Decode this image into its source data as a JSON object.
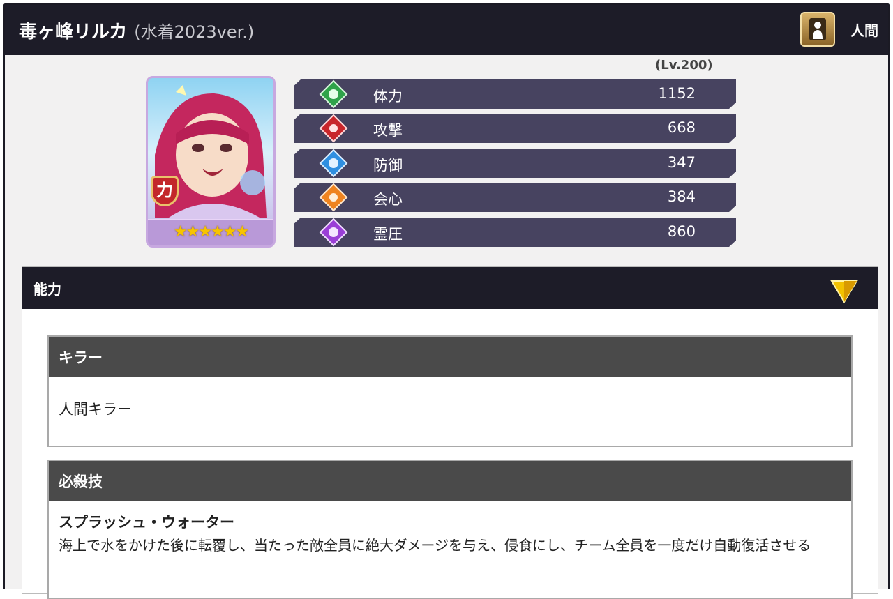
{
  "header": {
    "name": "毒ヶ峰リルカ",
    "version": "(水着2023ver.)",
    "type_label": "人間",
    "type_icon": "human-type-icon"
  },
  "card": {
    "attribute": "力",
    "stars": "★★★★★★"
  },
  "stats": {
    "level": "(Lv.200)",
    "rows": [
      {
        "label": "体力",
        "value": "1152",
        "icon": "stamina-icon",
        "color": "#2fa34a"
      },
      {
        "label": "攻撃",
        "value": "668",
        "icon": "attack-icon",
        "color": "#c8262b"
      },
      {
        "label": "防御",
        "value": "347",
        "icon": "defense-icon",
        "color": "#2f8fe0"
      },
      {
        "label": "会心",
        "value": "384",
        "icon": "critical-icon",
        "color": "#ef8420"
      },
      {
        "label": "霊圧",
        "value": "860",
        "icon": "reiatsu-icon",
        "color": "#9a3fd6"
      }
    ]
  },
  "ability": {
    "title": "能力",
    "killer": {
      "heading": "キラー",
      "text": "人間キラー"
    },
    "special": {
      "heading": "必殺技",
      "name": "スプラッシュ・ウォーター",
      "description": "海上で水をかけた後に転覆し、当たった敵全員に絶大ダメージを与え、侵食にし、チーム全員を一度だけ自動復活させる"
    }
  }
}
